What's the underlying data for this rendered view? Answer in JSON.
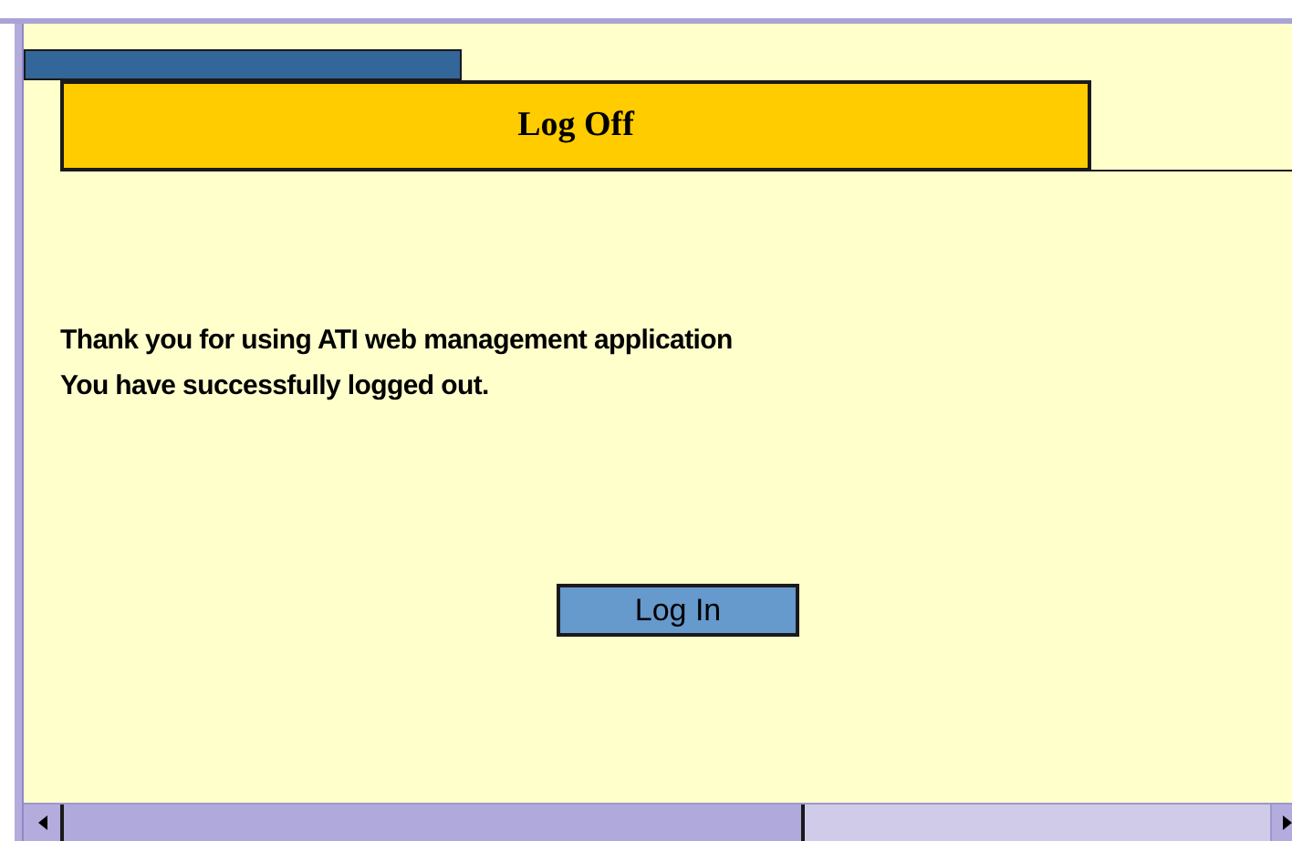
{
  "header": {
    "title": "Log Off"
  },
  "message": [
    "Thank you for using ATI web management application",
    "You have successfully logged out."
  ],
  "button": {
    "label": "Log In"
  }
}
